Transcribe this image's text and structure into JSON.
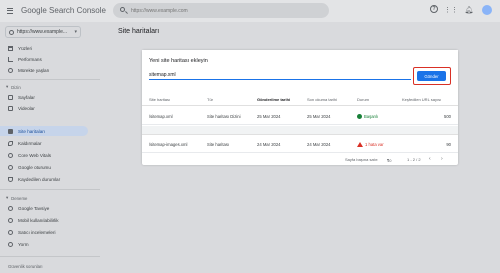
{
  "app": {
    "title_google": "Google",
    "title_product": "Search Console"
  },
  "search": {
    "placeholder": "https://www.example.com"
  },
  "property": {
    "label": "https://www.example..."
  },
  "sidebar": {
    "top": [
      {
        "label": "Yüzleri"
      },
      {
        "label": "Performans"
      },
      {
        "label": "Mürekte yaşları"
      }
    ],
    "section1": "Dizin",
    "section1_items": [
      {
        "label": "Sayfalar"
      },
      {
        "label": "Videolar"
      },
      {
        "label": "Site haritaları"
      },
      {
        "label": "Kaldırmalar"
      },
      {
        "label": "Core Web Vitals"
      },
      {
        "label": "Google oturumu"
      },
      {
        "label": "Kaydedilen durumlar"
      }
    ],
    "section2": "Deneme",
    "section2_items": [
      {
        "label": "Google Tavsiye"
      },
      {
        "label": "Mobil kullanılabilirlik"
      },
      {
        "label": "Satıcı incelemeleri"
      },
      {
        "label": "Yorm"
      }
    ],
    "footer": "Güvenlik sorunları"
  },
  "page": {
    "title": "Site haritaları"
  },
  "submit": {
    "title": "Yeni site haritası ekleyin",
    "value": "sitemap.xml",
    "button": "Gönder"
  },
  "table": {
    "headers": [
      "Site haritası",
      "Tür",
      "Gönderilme tarihi",
      "Son okuma tarihi",
      "Durum",
      "Keşfedilen URL sayısı"
    ],
    "rows": [
      {
        "sitemap": "/sitemap.xml",
        "type": "Site haritası Dizini",
        "submitted": "25 Mar 2024",
        "last_read": "25 Mar 2024",
        "status": "Başarılı",
        "urls": "500"
      },
      {
        "sitemap": "/sitemap-images.xml",
        "type": "Site haritası",
        "submitted": "24 Mar 2024",
        "last_read": "24 Mar 2024",
        "status": "1 hata var",
        "urls": "90"
      }
    ],
    "pager": {
      "rows_label": "Sayfa başına satır:",
      "rows_value": "10",
      "range": "1 - 2 / 2"
    }
  },
  "colors": {
    "accent": "#1a73e8",
    "highlight_border": "#d93025",
    "success": "#188038",
    "error": "#d93025"
  }
}
